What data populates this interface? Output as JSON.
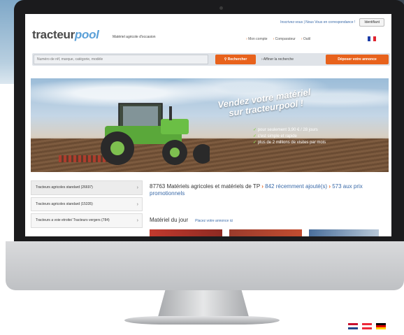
{
  "header": {
    "top_link": "Inscrivez-vous | Nous Vous en correspondance !",
    "login_label": "Identifiant",
    "logo_main": "tracteur",
    "logo_accent": "pool",
    "tagline": "Matériel agricole d'occasion",
    "account_links": [
      "Mon compte",
      "Comparateur",
      "Outil"
    ]
  },
  "search": {
    "placeholder": "Numéro de réf, marque, catégorie, modèle",
    "button_label": "Rechercher",
    "refine_label": "Affiner la recherche",
    "post_label": "Déposer votre annonce"
  },
  "banner": {
    "title_line1": "Vendez votre matériel",
    "title_line2": "sur tracteurpool !",
    "bullets": [
      "pour seulement 3,90 € / 28 jours",
      "c'est simple et rapide",
      "plus de 2 millions de visites par mois"
    ]
  },
  "sidebar": {
    "items": [
      {
        "label": "Tracteurs agricoles standard (26697)"
      },
      {
        "label": "Tracteurs agricoles standard (15335)"
      },
      {
        "label": "Tracteurs a voie etroite/ Tracteurs vergers (784)"
      }
    ]
  },
  "main": {
    "count_text": "87763 Matériels agricoles et matériels de TP",
    "recent_text": "842 récemment ajouté(s)",
    "promo_text": "573 aux prix promotionnels",
    "daily_title": "Matériel du jour",
    "daily_link": "Placez votre annonce ici"
  },
  "colors": {
    "accent_orange": "#e8621c",
    "link_blue": "#3a6aa8",
    "logo_blue": "#5aa0d8"
  }
}
